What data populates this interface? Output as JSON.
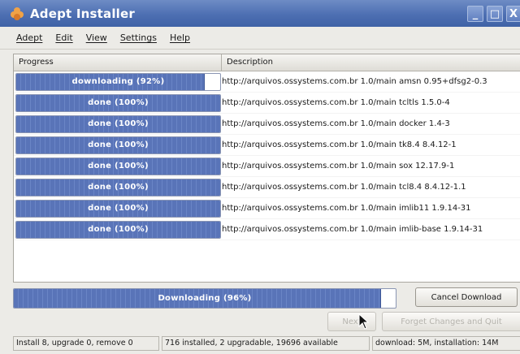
{
  "window": {
    "title": "Adept Installer",
    "controls": {
      "minimize": "_",
      "maximize": "□",
      "close": "X"
    }
  },
  "menu": [
    "Adept",
    "Edit",
    "View",
    "Settings",
    "Help"
  ],
  "list": {
    "headers": {
      "progress": "Progress",
      "description": "Description"
    },
    "rows": [
      {
        "status": "downloading (92%)",
        "progress": 92,
        "description": "http://arquivos.ossystems.com.br 1.0/main amsn 0.95+dfsg2-0.3"
      },
      {
        "status": "done (100%)",
        "progress": 100,
        "description": "http://arquivos.ossystems.com.br 1.0/main tcltls 1.5.0-4"
      },
      {
        "status": "done (100%)",
        "progress": 100,
        "description": "http://arquivos.ossystems.com.br 1.0/main docker 1.4-3"
      },
      {
        "status": "done (100%)",
        "progress": 100,
        "description": "http://arquivos.ossystems.com.br 1.0/main tk8.4 8.4.12-1"
      },
      {
        "status": "done (100%)",
        "progress": 100,
        "description": "http://arquivos.ossystems.com.br 1.0/main sox 12.17.9-1"
      },
      {
        "status": "done (100%)",
        "progress": 100,
        "description": "http://arquivos.ossystems.com.br 1.0/main tcl8.4 8.4.12-1.1"
      },
      {
        "status": "done (100%)",
        "progress": 100,
        "description": "http://arquivos.ossystems.com.br 1.0/main imlib11 1.9.14-31"
      },
      {
        "status": "done (100%)",
        "progress": 100,
        "description": "http://arquivos.ossystems.com.br 1.0/main imlib-base 1.9.14-31"
      }
    ]
  },
  "overall": {
    "label": "Downloading (96%)",
    "progress": 96
  },
  "buttons": {
    "cancel": "Cancel Download",
    "next": "Next",
    "forget": "Forget Changes and Quit"
  },
  "status": {
    "summary": "Install 8, upgrade 0, remove 0",
    "counts": "716 installed, 2 upgradable, 19696 available",
    "sizes": "download: 5M, installation: 14M"
  },
  "colors": {
    "titlebar": "#4d6fb2",
    "progress_fill": "#5974b8",
    "window_bg": "#ecebe7"
  }
}
